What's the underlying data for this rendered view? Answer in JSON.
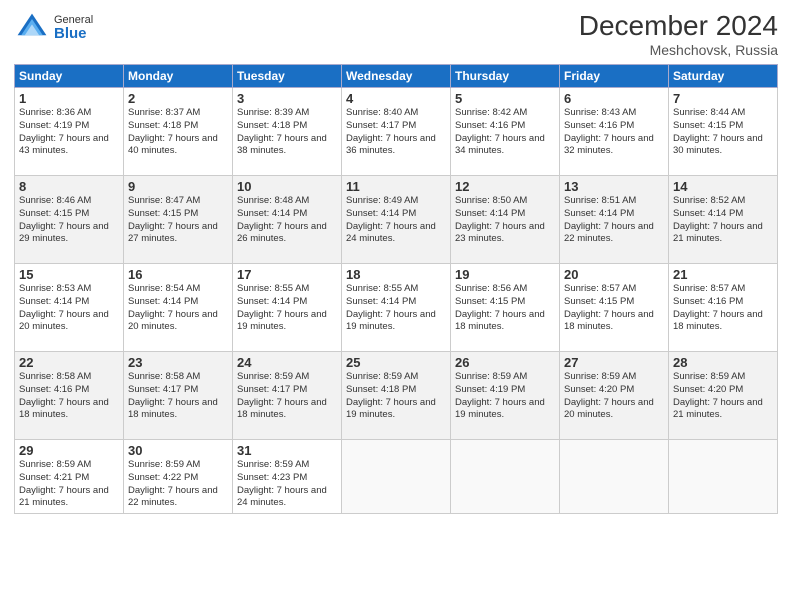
{
  "logo": {
    "general": "General",
    "blue": "Blue"
  },
  "title": "December 2024",
  "location": "Meshchovsk, Russia",
  "weekdays": [
    "Sunday",
    "Monday",
    "Tuesday",
    "Wednesday",
    "Thursday",
    "Friday",
    "Saturday"
  ],
  "weeks": [
    [
      {
        "day": "1",
        "sunrise": "Sunrise: 8:36 AM",
        "sunset": "Sunset: 4:19 PM",
        "daylight": "Daylight: 7 hours and 43 minutes."
      },
      {
        "day": "2",
        "sunrise": "Sunrise: 8:37 AM",
        "sunset": "Sunset: 4:18 PM",
        "daylight": "Daylight: 7 hours and 40 minutes."
      },
      {
        "day": "3",
        "sunrise": "Sunrise: 8:39 AM",
        "sunset": "Sunset: 4:18 PM",
        "daylight": "Daylight: 7 hours and 38 minutes."
      },
      {
        "day": "4",
        "sunrise": "Sunrise: 8:40 AM",
        "sunset": "Sunset: 4:17 PM",
        "daylight": "Daylight: 7 hours and 36 minutes."
      },
      {
        "day": "5",
        "sunrise": "Sunrise: 8:42 AM",
        "sunset": "Sunset: 4:16 PM",
        "daylight": "Daylight: 7 hours and 34 minutes."
      },
      {
        "day": "6",
        "sunrise": "Sunrise: 8:43 AM",
        "sunset": "Sunset: 4:16 PM",
        "daylight": "Daylight: 7 hours and 32 minutes."
      },
      {
        "day": "7",
        "sunrise": "Sunrise: 8:44 AM",
        "sunset": "Sunset: 4:15 PM",
        "daylight": "Daylight: 7 hours and 30 minutes."
      }
    ],
    [
      {
        "day": "8",
        "sunrise": "Sunrise: 8:46 AM",
        "sunset": "Sunset: 4:15 PM",
        "daylight": "Daylight: 7 hours and 29 minutes."
      },
      {
        "day": "9",
        "sunrise": "Sunrise: 8:47 AM",
        "sunset": "Sunset: 4:15 PM",
        "daylight": "Daylight: 7 hours and 27 minutes."
      },
      {
        "day": "10",
        "sunrise": "Sunrise: 8:48 AM",
        "sunset": "Sunset: 4:14 PM",
        "daylight": "Daylight: 7 hours and 26 minutes."
      },
      {
        "day": "11",
        "sunrise": "Sunrise: 8:49 AM",
        "sunset": "Sunset: 4:14 PM",
        "daylight": "Daylight: 7 hours and 24 minutes."
      },
      {
        "day": "12",
        "sunrise": "Sunrise: 8:50 AM",
        "sunset": "Sunset: 4:14 PM",
        "daylight": "Daylight: 7 hours and 23 minutes."
      },
      {
        "day": "13",
        "sunrise": "Sunrise: 8:51 AM",
        "sunset": "Sunset: 4:14 PM",
        "daylight": "Daylight: 7 hours and 22 minutes."
      },
      {
        "day": "14",
        "sunrise": "Sunrise: 8:52 AM",
        "sunset": "Sunset: 4:14 PM",
        "daylight": "Daylight: 7 hours and 21 minutes."
      }
    ],
    [
      {
        "day": "15",
        "sunrise": "Sunrise: 8:53 AM",
        "sunset": "Sunset: 4:14 PM",
        "daylight": "Daylight: 7 hours and 20 minutes."
      },
      {
        "day": "16",
        "sunrise": "Sunrise: 8:54 AM",
        "sunset": "Sunset: 4:14 PM",
        "daylight": "Daylight: 7 hours and 20 minutes."
      },
      {
        "day": "17",
        "sunrise": "Sunrise: 8:55 AM",
        "sunset": "Sunset: 4:14 PM",
        "daylight": "Daylight: 7 hours and 19 minutes."
      },
      {
        "day": "18",
        "sunrise": "Sunrise: 8:55 AM",
        "sunset": "Sunset: 4:14 PM",
        "daylight": "Daylight: 7 hours and 19 minutes."
      },
      {
        "day": "19",
        "sunrise": "Sunrise: 8:56 AM",
        "sunset": "Sunset: 4:15 PM",
        "daylight": "Daylight: 7 hours and 18 minutes."
      },
      {
        "day": "20",
        "sunrise": "Sunrise: 8:57 AM",
        "sunset": "Sunset: 4:15 PM",
        "daylight": "Daylight: 7 hours and 18 minutes."
      },
      {
        "day": "21",
        "sunrise": "Sunrise: 8:57 AM",
        "sunset": "Sunset: 4:16 PM",
        "daylight": "Daylight: 7 hours and 18 minutes."
      }
    ],
    [
      {
        "day": "22",
        "sunrise": "Sunrise: 8:58 AM",
        "sunset": "Sunset: 4:16 PM",
        "daylight": "Daylight: 7 hours and 18 minutes."
      },
      {
        "day": "23",
        "sunrise": "Sunrise: 8:58 AM",
        "sunset": "Sunset: 4:17 PM",
        "daylight": "Daylight: 7 hours and 18 minutes."
      },
      {
        "day": "24",
        "sunrise": "Sunrise: 8:59 AM",
        "sunset": "Sunset: 4:17 PM",
        "daylight": "Daylight: 7 hours and 18 minutes."
      },
      {
        "day": "25",
        "sunrise": "Sunrise: 8:59 AM",
        "sunset": "Sunset: 4:18 PM",
        "daylight": "Daylight: 7 hours and 19 minutes."
      },
      {
        "day": "26",
        "sunrise": "Sunrise: 8:59 AM",
        "sunset": "Sunset: 4:19 PM",
        "daylight": "Daylight: 7 hours and 19 minutes."
      },
      {
        "day": "27",
        "sunrise": "Sunrise: 8:59 AM",
        "sunset": "Sunset: 4:20 PM",
        "daylight": "Daylight: 7 hours and 20 minutes."
      },
      {
        "day": "28",
        "sunrise": "Sunrise: 8:59 AM",
        "sunset": "Sunset: 4:20 PM",
        "daylight": "Daylight: 7 hours and 21 minutes."
      }
    ],
    [
      {
        "day": "29",
        "sunrise": "Sunrise: 8:59 AM",
        "sunset": "Sunset: 4:21 PM",
        "daylight": "Daylight: 7 hours and 21 minutes."
      },
      {
        "day": "30",
        "sunrise": "Sunrise: 8:59 AM",
        "sunset": "Sunset: 4:22 PM",
        "daylight": "Daylight: 7 hours and 22 minutes."
      },
      {
        "day": "31",
        "sunrise": "Sunrise: 8:59 AM",
        "sunset": "Sunset: 4:23 PM",
        "daylight": "Daylight: 7 hours and 24 minutes."
      },
      null,
      null,
      null,
      null
    ]
  ]
}
